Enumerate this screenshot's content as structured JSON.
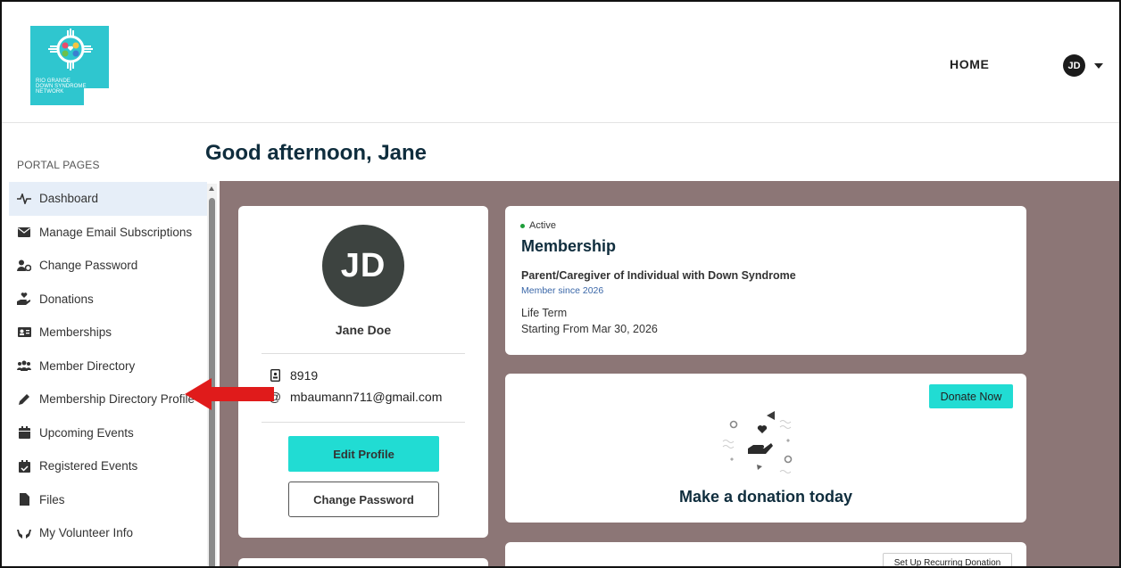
{
  "logo": {
    "text_lines": [
      "RIO GRANDE",
      "DOWN SYNDROME",
      "NETWORK"
    ],
    "color": "#2fc6cf"
  },
  "header": {
    "nav_home": "HOME",
    "user_initials": "JD",
    "caret_icon": "caret-down-icon"
  },
  "sidebar": {
    "title": "PORTAL PAGES",
    "items": [
      {
        "label": "Dashboard",
        "icon": "pulse-icon",
        "active": true
      },
      {
        "label": "Manage Email Subscriptions",
        "icon": "envelope-icon"
      },
      {
        "label": "Change Password",
        "icon": "user-gear-icon"
      },
      {
        "label": "Donations",
        "icon": "hand-holding-heart-icon"
      },
      {
        "label": "Memberships",
        "icon": "id-card-icon"
      },
      {
        "label": "Member Directory",
        "icon": "users-icon"
      },
      {
        "label": "Membership Directory Profile",
        "icon": "pencil-icon"
      },
      {
        "label": "Upcoming Events",
        "icon": "calendar-icon"
      },
      {
        "label": "Registered Events",
        "icon": "calendar-check-icon"
      },
      {
        "label": "Files",
        "icon": "file-icon"
      },
      {
        "label": "My Volunteer Info",
        "icon": "hands-icon"
      }
    ]
  },
  "page": {
    "title": "Good afternoon, Jane"
  },
  "profile": {
    "initials": "JD",
    "name": "Jane Doe",
    "member_id": "8919",
    "email": "mbaumann711@gmail.com",
    "edit_label": "Edit Profile",
    "change_password_label": "Change Password"
  },
  "membership": {
    "status": "Active",
    "title": "Membership",
    "type": "Parent/Caregiver of Individual with Down Syndrome",
    "since": "Member since 2026",
    "term": "Life Term",
    "start": "Starting From Mar 30, 2026"
  },
  "donation": {
    "button_label": "Donate Now",
    "headline": "Make a donation today",
    "recurring_label": "Set Up Recurring Donation"
  },
  "colors": {
    "accent": "#21dcd3",
    "main_bg": "#8c7676",
    "heading": "#0f2d3d",
    "arrow": "#e01b1b"
  }
}
